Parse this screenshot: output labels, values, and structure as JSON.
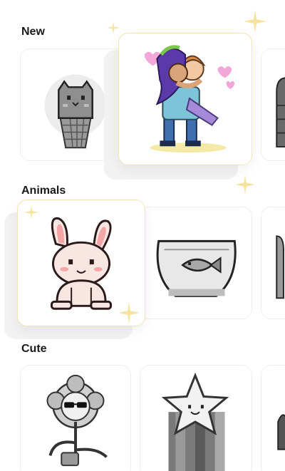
{
  "sections": {
    "new": {
      "title": "New"
    },
    "animals": {
      "title": "Animals"
    },
    "cute": {
      "title": "Cute"
    }
  },
  "artworks": {
    "new": [
      "cat-icecream",
      "couple-piggyback",
      "partial-grey"
    ],
    "animals": [
      "bunny",
      "fish-bowl",
      "partial-grey"
    ],
    "cute": [
      "flower-sunglasses",
      "star-rainbow",
      "partial-grey"
    ]
  },
  "colors": {
    "highlight_border": "#f3e6b4",
    "sparkle": "#f6e3a0",
    "bunny_ear": "#f4a6a6",
    "heart": "#f3a6d8"
  }
}
